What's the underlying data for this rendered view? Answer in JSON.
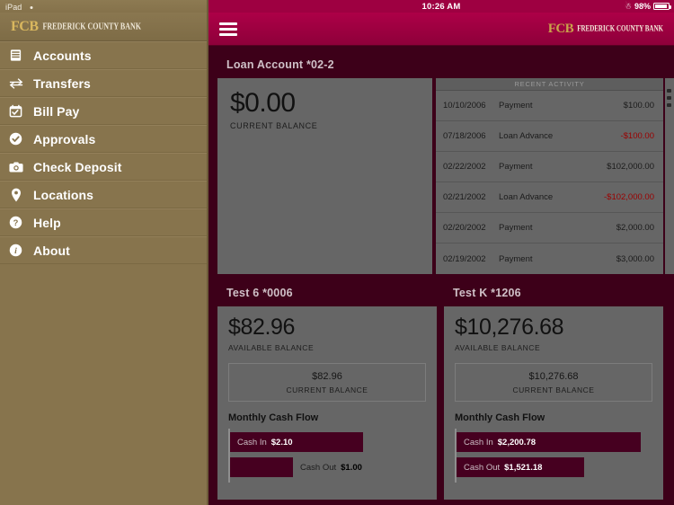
{
  "device": {
    "name": "iPad",
    "wifi_icon": "wifi-icon"
  },
  "statusbar": {
    "time": "10:26 AM",
    "battery_percent": "98%",
    "bluetooth_icon": "bluetooth-icon",
    "battery_icon": "battery-icon"
  },
  "brand": {
    "abbr": "FCB",
    "name": "Frederick County Bank"
  },
  "sidebar": {
    "items": [
      {
        "label": "Accounts",
        "icon": "accounts-icon"
      },
      {
        "label": "Transfers",
        "icon": "transfers-icon"
      },
      {
        "label": "Bill Pay",
        "icon": "billpay-calendar-icon"
      },
      {
        "label": "Approvals",
        "icon": "check-circle-icon"
      },
      {
        "label": "Check Deposit",
        "icon": "camera-icon"
      },
      {
        "label": "Locations",
        "icon": "map-pin-icon"
      },
      {
        "label": "Help",
        "icon": "question-circle-icon"
      },
      {
        "label": "About",
        "icon": "info-circle-icon"
      }
    ]
  },
  "navbar": {
    "menu_icon": "hamburger-menu-icon"
  },
  "loan_card": {
    "title": "Loan Account *02-2",
    "balance": "$0.00",
    "balance_label": "CURRENT BALANCE",
    "activity_header": "RECENT ACTIVITY",
    "transactions": [
      {
        "date": "10/10/2006",
        "description": "Payment",
        "amount": "$100.00",
        "negative": false
      },
      {
        "date": "07/18/2006",
        "description": "Loan Advance",
        "amount": "-$100.00",
        "negative": true
      },
      {
        "date": "02/22/2002",
        "description": "Payment",
        "amount": "$102,000.00",
        "negative": false
      },
      {
        "date": "02/21/2002",
        "description": "Loan Advance",
        "amount": "-$102,000.00",
        "negative": true
      },
      {
        "date": "02/20/2002",
        "description": "Payment",
        "amount": "$2,000.00",
        "negative": false
      },
      {
        "date": "02/19/2002",
        "description": "Payment",
        "amount": "$3,000.00",
        "negative": false
      }
    ]
  },
  "account_cards": [
    {
      "title": "Test 6 *0006",
      "available_balance": "$82.96",
      "available_label": "AVAILABLE BALANCE",
      "current_balance": "$82.96",
      "current_label": "CURRENT BALANCE",
      "cashflow_title": "Monthly Cash Flow",
      "cash_in_label": "Cash In",
      "cash_in_value": "$2.10",
      "cash_out_label": "Cash Out",
      "cash_out_value": "$1.00"
    },
    {
      "title": "Test K *1206",
      "available_balance": "$10,276.68",
      "available_label": "AVAILABLE BALANCE",
      "current_balance": "$10,276.68",
      "current_label": "CURRENT BALANCE",
      "cashflow_title": "Monthly Cash Flow",
      "cash_in_label": "Cash In",
      "cash_in_value": "$2,200.78",
      "cash_out_label": "Cash Out",
      "cash_out_value": "$1,521.18"
    }
  ],
  "colors": {
    "brand_crimson": "#9e0041",
    "nav_gradient_top": "#ad0047",
    "app_background": "#3d0019",
    "sidebar": "#87744d",
    "card_surface": "#666666",
    "bar_fill": "#460020",
    "negative_amount": "#9b0000",
    "logo_gold": "#c9a24a"
  }
}
